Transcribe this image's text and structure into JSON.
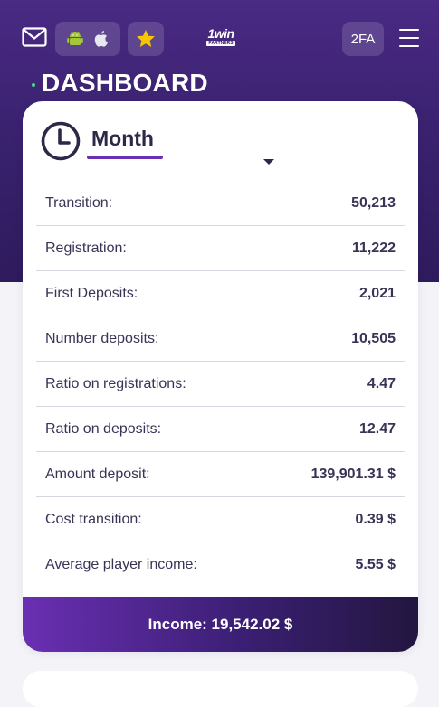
{
  "header": {
    "logo_main": "1win",
    "logo_sub": "PARTNERS",
    "twofa_label": "2FA"
  },
  "page": {
    "title": "DASHBOARD"
  },
  "period": {
    "selected": "Month"
  },
  "stats": [
    {
      "label": "Transition:",
      "value": "50,213"
    },
    {
      "label": "Registration:",
      "value": "11,222"
    },
    {
      "label": "First Deposits:",
      "value": "2,021"
    },
    {
      "label": "Number deposits:",
      "value": "10,505"
    },
    {
      "label": "Ratio on registrations:",
      "value": "4.47"
    },
    {
      "label": "Ratio on deposits:",
      "value": "12.47"
    },
    {
      "label": "Amount deposit:",
      "value": "139,901.31 $"
    },
    {
      "label": "Cost transition:",
      "value": "0.39 $"
    },
    {
      "label": "Average player income:",
      "value": "5.55 $"
    }
  ],
  "income": {
    "text": "Income: 19,542.02 $"
  },
  "colors": {
    "brand_purple": "#3a2270",
    "accent_purple": "#6a2fb2",
    "android_green": "#a4c639",
    "star_yellow": "#f7c600"
  },
  "icons": [
    "mail-icon",
    "android-icon",
    "apple-icon",
    "star-icon",
    "menu-icon",
    "clock-icon",
    "chevron-down-icon"
  ]
}
